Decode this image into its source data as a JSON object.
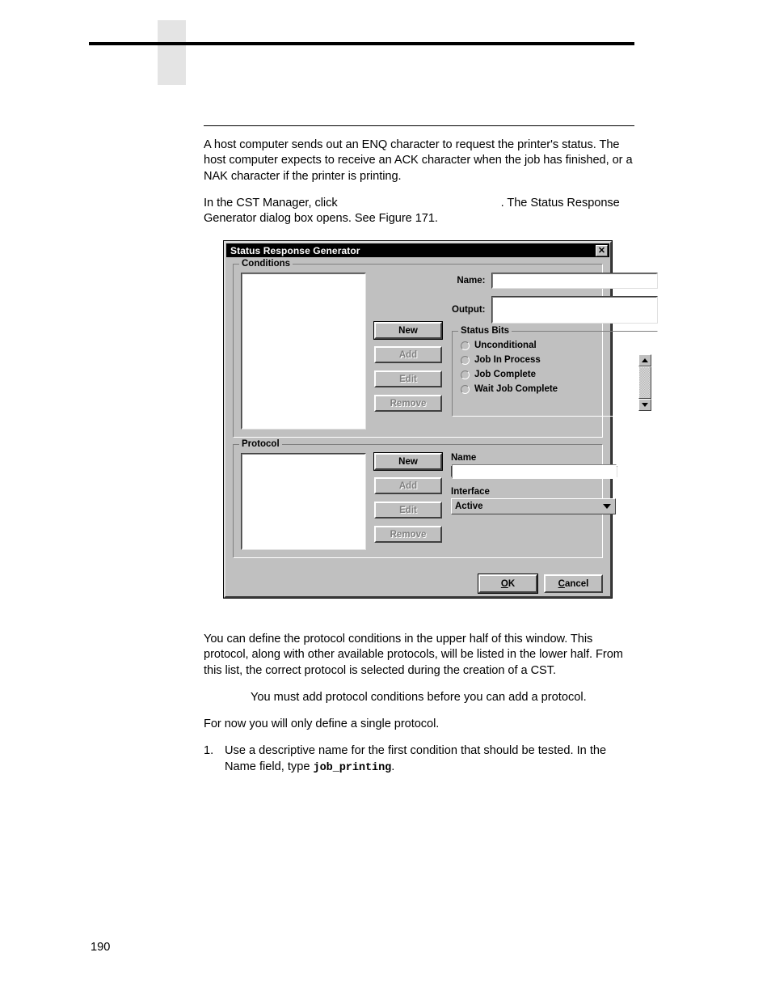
{
  "page": {
    "number": "190"
  },
  "intro": {
    "para1": "A host computer sends out an ENQ character to request the printer's status. The host computer expects to receive an ACK character when the job has finished, or a NAK character if the printer is printing.",
    "para2_before": "In the CST Manager, click",
    "para2_after": ". The Status Response Generator dialog box opens. See Figure 171."
  },
  "dialog": {
    "title": "Status Response Generator",
    "close_label": "✕",
    "conditions": {
      "legend": "Conditions",
      "name_label": "Name:",
      "name_value": "",
      "output_label": "Output:",
      "output_value": "",
      "buttons": [
        {
          "label": "New",
          "disabled": false
        },
        {
          "label": "Add",
          "disabled": true
        },
        {
          "label": "Edit",
          "disabled": true
        },
        {
          "label": "Remove",
          "disabled": true
        }
      ],
      "status_bits": {
        "legend": "Status Bits",
        "options": [
          {
            "label": "Unconditional",
            "selected": false
          },
          {
            "label": "Job In Process",
            "selected": false
          },
          {
            "label": "Job Complete",
            "selected": false
          },
          {
            "label": "Wait Job Complete",
            "selected": false
          }
        ]
      }
    },
    "protocol": {
      "legend": "Protocol",
      "buttons": [
        {
          "label": "New",
          "disabled": false
        },
        {
          "label": "Add",
          "disabled": true
        },
        {
          "label": "Edit",
          "disabled": true
        },
        {
          "label": "Remove",
          "disabled": true
        }
      ],
      "name_label": "Name",
      "name_value": "",
      "interface_label": "Interface",
      "interface_value": "Active"
    },
    "footer": {
      "ok_accel": "O",
      "ok_rest": "K",
      "cancel_accel": "C",
      "cancel_rest": "ancel"
    }
  },
  "outro": {
    "para1": "You can define the protocol conditions in the upper half of this window. This protocol, along with other available protocols, will be listed in the lower half. From this list, the correct protocol is selected during the creation of a CST.",
    "note": "You must add protocol conditions before you can add a protocol.",
    "para2": "For now you will only define a single protocol.",
    "step1_num": "1.",
    "step1_text_a": "Use a descriptive name for the first condition that should be tested. In the Name field, type ",
    "step1_code": "job_printing",
    "step1_text_b": "."
  },
  "colors": {
    "dialog_face": "#c0c0c0",
    "titlebar": "#000000",
    "field_white": "#ffffff",
    "disabled_text": "#808080",
    "header_block": "#e4e4e4"
  }
}
